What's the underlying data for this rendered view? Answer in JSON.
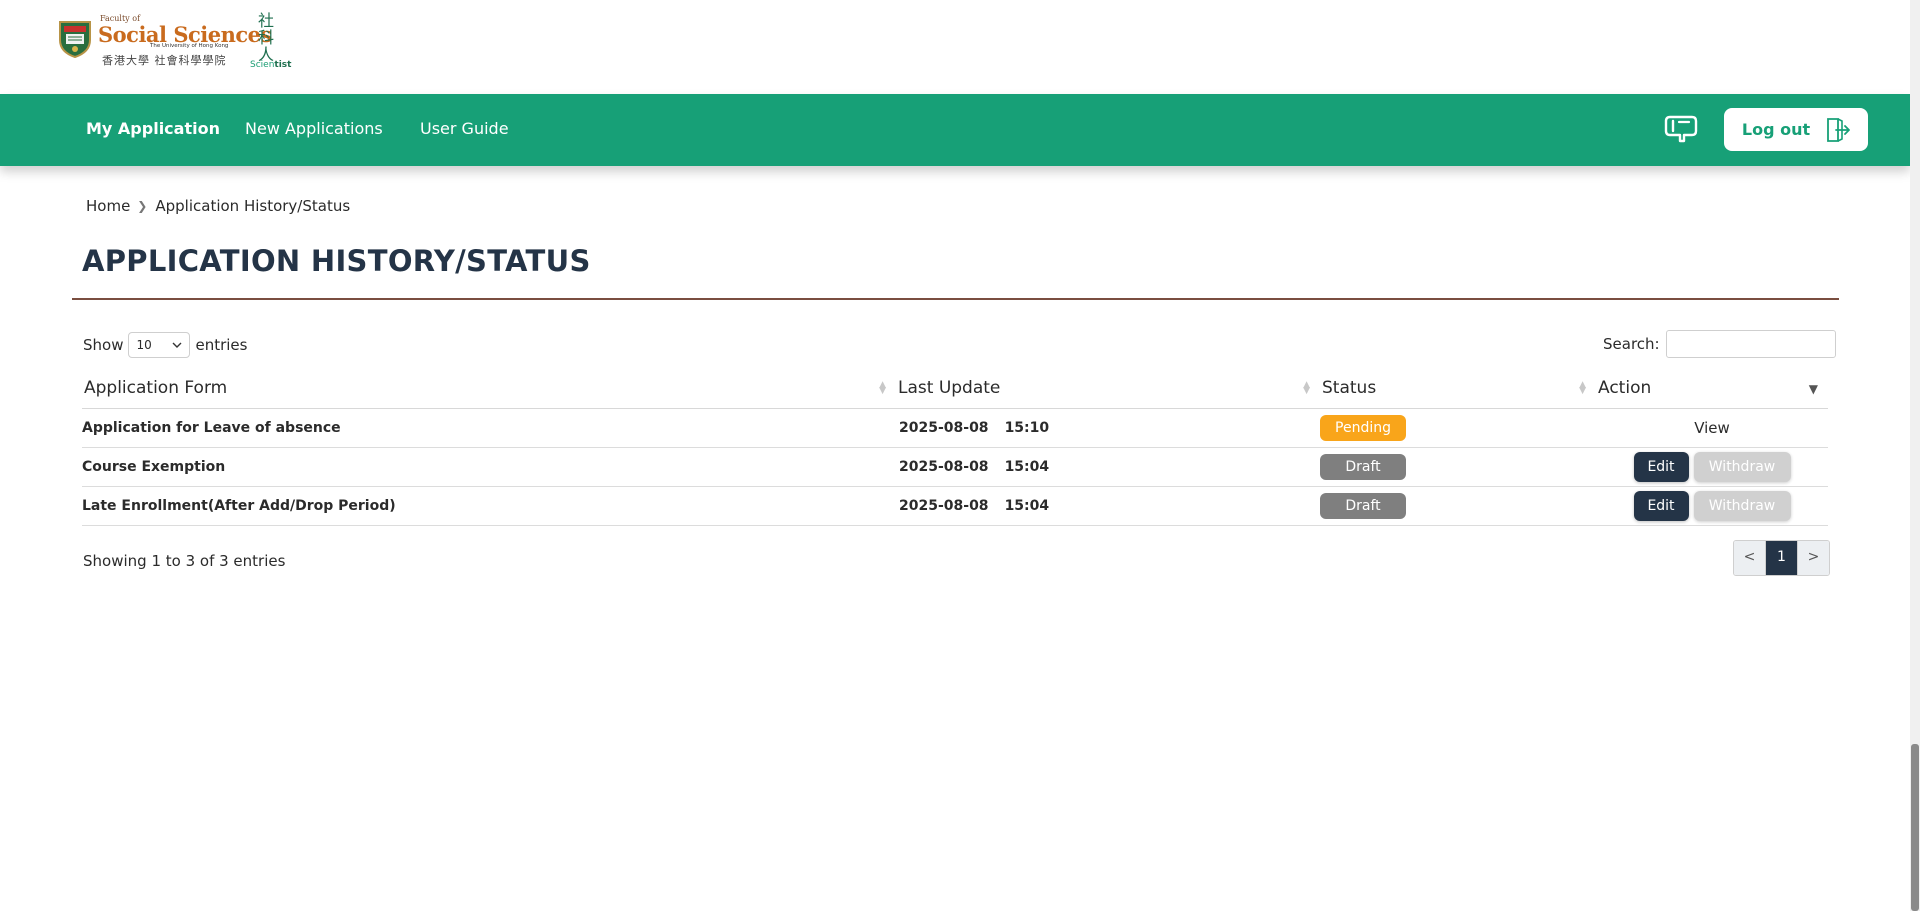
{
  "logo": {
    "faculty_of": "Faculty of",
    "wordmark": "Social Sciences",
    "university": "The University of Hong Kong",
    "chinese_name": "香港大學 社會科學學院",
    "scientist_cn": "社科人",
    "scientist_a": "Scien",
    "scientist_b": "tist"
  },
  "nav": {
    "items": [
      {
        "label": "My Application",
        "active": true
      },
      {
        "label": "New Applications",
        "active": false
      },
      {
        "label": "User Guide",
        "active": false
      }
    ],
    "logout_label": "Log out",
    "accent": "#17a077"
  },
  "breadcrumb": {
    "home": "Home",
    "current": "Application History/Status"
  },
  "page_title": "APPLICATION HISTORY/STATUS",
  "table_controls": {
    "show_label": "Show",
    "page_size": "10",
    "entries_label": "entries",
    "search_label": "Search:",
    "search_value": ""
  },
  "table": {
    "columns": [
      "Application Form",
      "Last Update",
      "Status",
      "Action"
    ],
    "rows": [
      {
        "form": "Application for Leave of absence",
        "date": "2025-08-08",
        "time": "15:10",
        "status": "Pending",
        "action_view": "View"
      },
      {
        "form": "Course Exemption",
        "date": "2025-08-08",
        "time": "15:04",
        "status": "Draft",
        "action_edit": "Edit",
        "action_withdraw": "Withdraw"
      },
      {
        "form": "Late Enrollment(After Add/Drop Period)",
        "date": "2025-08-08",
        "time": "15:04",
        "status": "Draft",
        "action_edit": "Edit",
        "action_withdraw": "Withdraw"
      }
    ]
  },
  "footer_info": "Showing 1 to 3 of 3 entries",
  "pagination": {
    "prev": "<",
    "current": "1",
    "next": ">"
  },
  "colors": {
    "pending": "#f9a51a",
    "draft": "#7f7f7f",
    "dark_button": "#243447"
  }
}
